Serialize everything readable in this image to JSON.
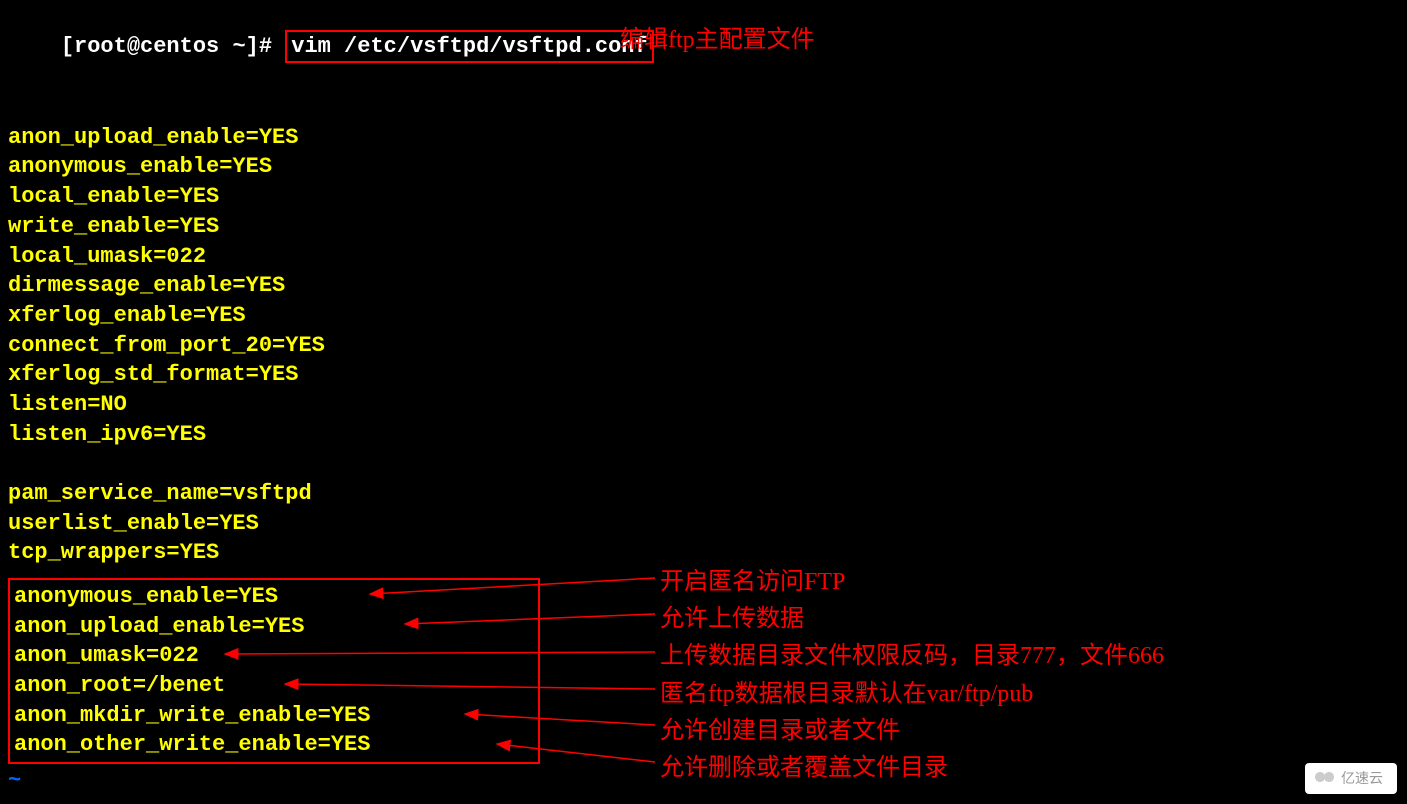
{
  "terminal": {
    "prompt_prefix": "[root@centos ~]#",
    "command": "vim /etc/vsftpd/vsftpd.conf",
    "annotation_cmd": "编辑ftp主配置文件",
    "block1": [
      "anon_upload_enable=YES",
      "anonymous_enable=YES",
      "local_enable=YES",
      "write_enable=YES",
      "local_umask=022",
      "dirmessage_enable=YES",
      "xferlog_enable=YES",
      "connect_from_port_20=YES",
      "xferlog_std_format=YES",
      "listen=NO",
      "listen_ipv6=YES"
    ],
    "block1b": [
      "pam_service_name=vsftpd",
      "userlist_enable=YES",
      "tcp_wrappers=YES"
    ],
    "block2": [
      "anonymous_enable=YES",
      "anon_upload_enable=YES",
      "anon_umask=022",
      "anon_root=/benet",
      "anon_mkdir_write_enable=YES",
      "anon_other_write_enable=YES"
    ],
    "annotations_block2": [
      "开启匿名访问FTP",
      "允许上传数据",
      "上传数据目录文件权限反码，目录777，文件666",
      "匿名ftp数据根目录默认在var/ftp/pub",
      "允许创建目录或者文件",
      "允许删除或者覆盖文件目录"
    ],
    "tilde": "~",
    "watermark": "亿速云"
  }
}
